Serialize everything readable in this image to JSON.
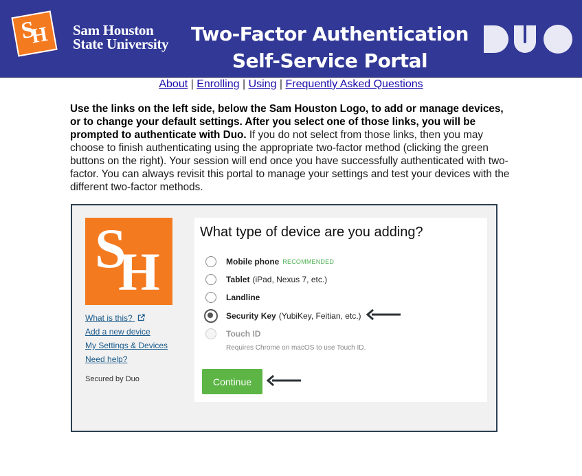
{
  "header": {
    "logo_letters": [
      "S",
      "H"
    ],
    "university_line1": "Sam Houston",
    "university_line2": "State University",
    "title_line1": "Two-Factor Authentication",
    "title_line2": "Self-Service Portal",
    "duo_logo": "DUO"
  },
  "nav": {
    "about": "About",
    "enrolling": "Enrolling",
    "using": "Using",
    "faq": "Frequently Asked Questions",
    "separator": "|"
  },
  "intro": {
    "bold_text": "Use the links on the left side, below the Sam Houston Logo, to add or manage devices, or to change your default settings. After you select one of those links, you will be prompted to authenticate with Duo.",
    "normal_text": "If you do not select from those links, then you may choose to finish authenticating using the appropriate two-factor method (clicking the green buttons on the right). Your session will end once you have successfully authenticated with two-factor. You can always revisit this portal to manage your settings and test your devices with the different two-factor methods."
  },
  "sidebar": {
    "logo_letters": [
      "S",
      "H"
    ],
    "what_is_this": "What is this?",
    "add_device": "Add a new device",
    "my_settings": "My Settings & Devices",
    "need_help": "Need help?",
    "secured": "Secured by Duo"
  },
  "prompt": {
    "question": "What type of device are you adding?",
    "options": [
      {
        "label": "Mobile phone",
        "detail": "",
        "badge": "RECOMMENDED"
      },
      {
        "label": "Tablet",
        "detail": "(iPad, Nexus 7, etc.)"
      },
      {
        "label": "Landline",
        "detail": ""
      },
      {
        "label": "Security Key",
        "detail": "(YubiKey, Feitian, etc.)"
      },
      {
        "label": "Touch ID",
        "detail": ""
      }
    ],
    "touch_id_note": "Requires Chrome on macOS to use Touch ID.",
    "selected_option": "Security Key",
    "continue_label": "Continue"
  },
  "colors": {
    "header_bg": "#313896",
    "brand_orange": "#f47a20",
    "continue_green": "#5cb545",
    "recommended_green": "#4caf50"
  }
}
